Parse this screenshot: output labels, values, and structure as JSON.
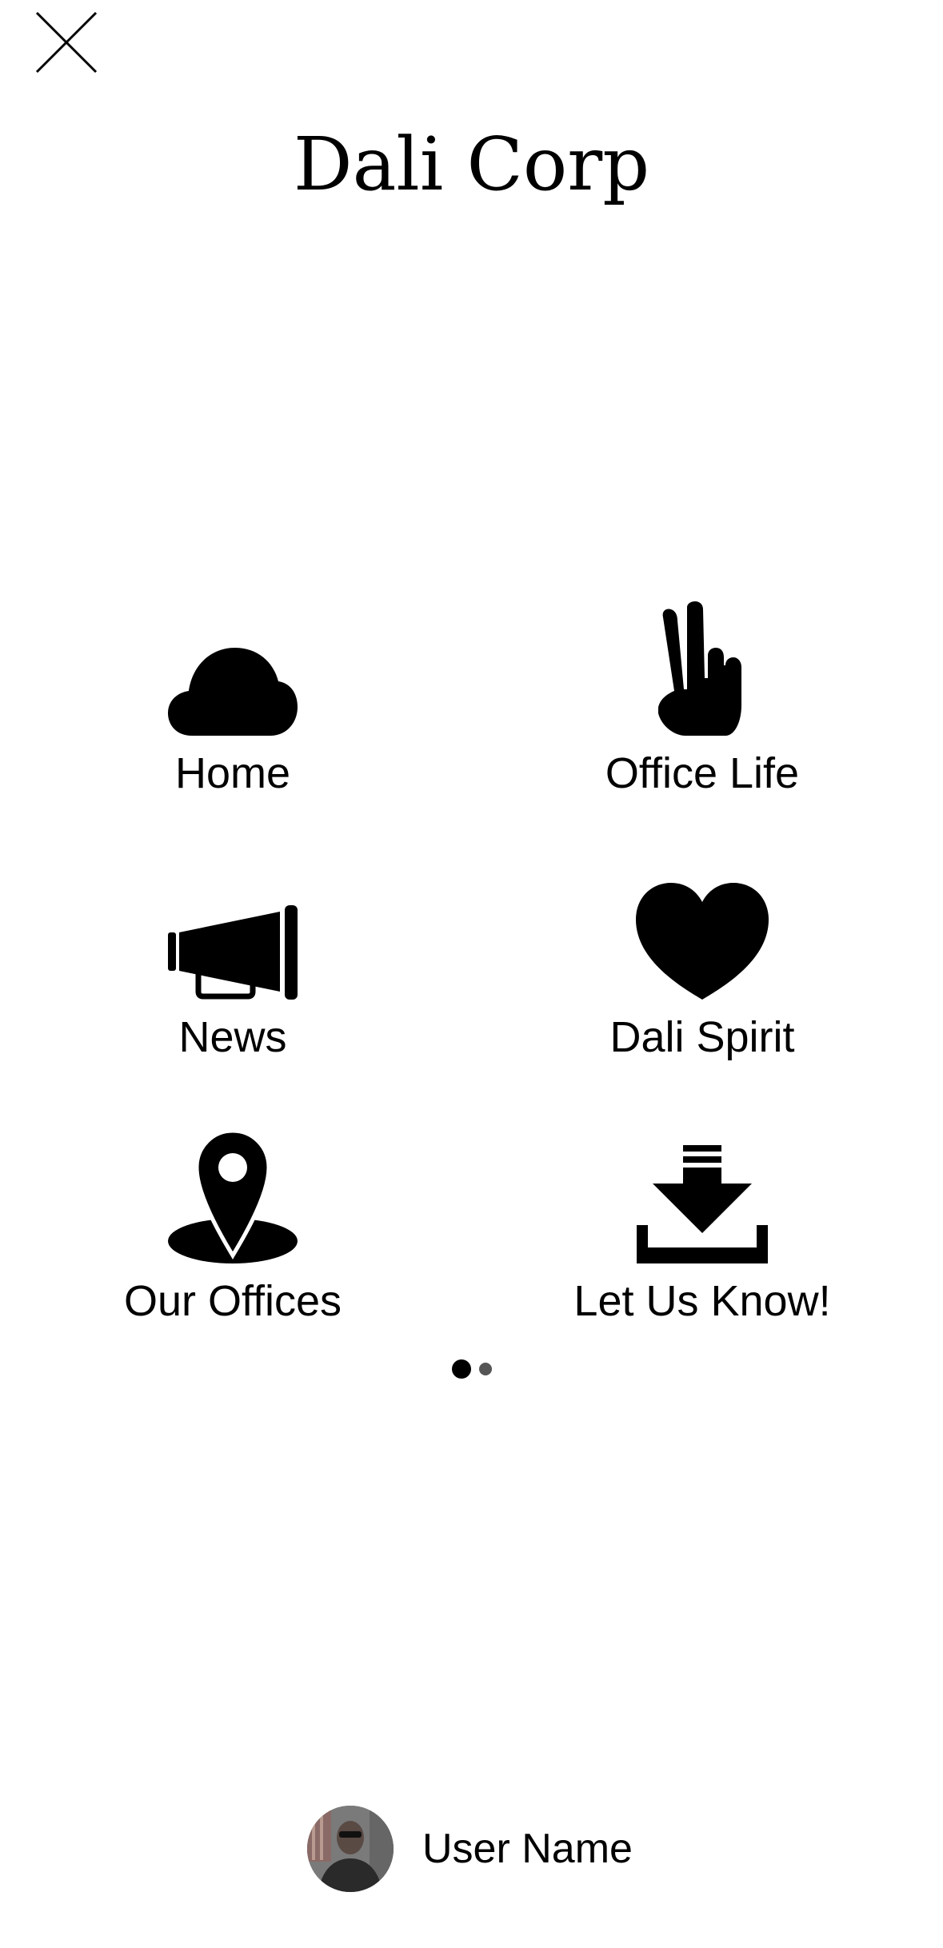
{
  "app": {
    "title": "Dali Corp"
  },
  "menu": {
    "items": [
      {
        "label": "Home",
        "icon": "cloud-icon"
      },
      {
        "label": "Office Life",
        "icon": "peace-hand-icon"
      },
      {
        "label": "News",
        "icon": "megaphone-icon"
      },
      {
        "label": "Dali Spirit",
        "icon": "heart-icon"
      },
      {
        "label": "Our Offices",
        "icon": "map-pin-icon"
      },
      {
        "label": "Let Us Know!",
        "icon": "download-inbox-icon"
      }
    ]
  },
  "pager": {
    "current_page": 1,
    "total_pages": 2
  },
  "user": {
    "name": "User Name"
  },
  "colors": {
    "foreground": "#000000",
    "background": "#ffffff",
    "inactive_dot": "#555555"
  }
}
